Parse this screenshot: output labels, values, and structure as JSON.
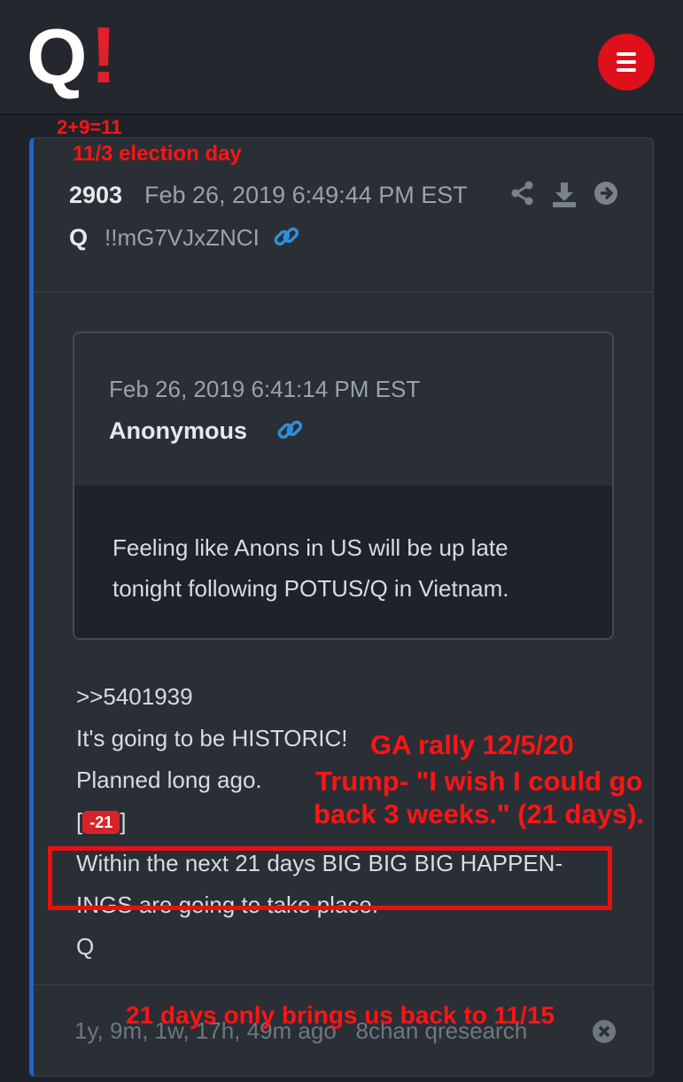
{
  "header": {
    "logo_text": "Q",
    "logo_mark": "!",
    "menu_icon": "hamburger-icon",
    "colors": {
      "header_bg": "#24282e",
      "brand_red": "#e0101b",
      "accent_blue": "#1f62c9"
    }
  },
  "annotations": {
    "sum": "2+9=11",
    "election": "11/3  election day",
    "rally_line1": "GA rally 12/5/20",
    "rally_line2": "Trump- \"I wish I could go",
    "rally_line3": "back 3 weeks.\" (21 days).",
    "bottom": "21 days only brings us back to 11/15",
    "color": "#ff1414"
  },
  "post": {
    "number": "2903",
    "date": "Feb 26, 2019 6:49:44 PM EST",
    "author": "Q",
    "tripcode": "!!mG7VJxZNCI",
    "icons": [
      "share-icon",
      "download-icon",
      "arrow-right-icon",
      "link-icon"
    ],
    "quote": {
      "date": "Feb 26, 2019 6:41:14 PM EST",
      "author": "Anonymous",
      "text_line1": "Feeling like Anons in US will be up late",
      "text_line2": "tonight following POTUS/Q in Vietnam."
    },
    "message": {
      "line1": ">>5401939",
      "line2": "It's going to be HISTORIC!",
      "line3": "Planned long ago.",
      "bracket_open": "[",
      "badge": "-21",
      "bracket_close": "]",
      "line5": "Within the next 21 days BIG BIG BIG HAPPEN-",
      "line6": "INGS are going to take place.",
      "line7": "Q"
    },
    "footer": {
      "ago": "1y, 9m, 1w, 17h, 49m ago",
      "source": "8chan qresearch"
    }
  }
}
